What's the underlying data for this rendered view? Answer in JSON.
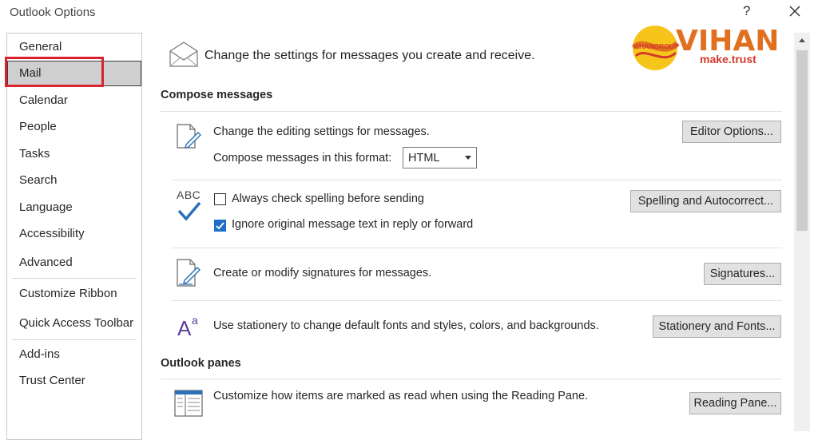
{
  "window": {
    "title": "Outlook Options",
    "help_label": "?"
  },
  "sidebar": {
    "items": [
      {
        "label": "General"
      },
      {
        "label": "Mail"
      },
      {
        "label": "Calendar"
      },
      {
        "label": "People"
      },
      {
        "label": "Tasks"
      },
      {
        "label": "Search"
      },
      {
        "label": "Language"
      },
      {
        "label": "Accessibility"
      },
      {
        "label": "Advanced"
      },
      {
        "label": "Customize Ribbon"
      },
      {
        "label": "Quick Access Toolbar"
      },
      {
        "label": "Add-ins"
      },
      {
        "label": "Trust Center"
      }
    ],
    "selected": "Mail"
  },
  "header": {
    "text": "Change the settings for messages you create and receive."
  },
  "logo": {
    "brand": "VIHAN",
    "tagline": "make.trust",
    "circle_text": "VIHANGROUP"
  },
  "compose": {
    "title": "Compose messages",
    "editing_text": "Change the editing settings for messages.",
    "editor_button": "Editor Options...",
    "format_label": "Compose messages in this format:",
    "format_value": "HTML",
    "abc_label": "ABC",
    "always_check_label": "Always check spelling before sending",
    "always_check_checked": false,
    "ignore_original_label": "Ignore original message text in reply or forward",
    "ignore_original_checked": true,
    "spelling_button": "Spelling and Autocorrect...",
    "signatures_text": "Create or modify signatures for messages.",
    "signatures_button": "Signatures...",
    "stationery_text": "Use stationery to change default fonts and styles, colors, and backgrounds.",
    "stationery_button": "Stationery and Fonts..."
  },
  "panes": {
    "title": "Outlook panes",
    "reading_text": "Customize how items are marked as read when using the Reading Pane.",
    "reading_button": "Reading Pane..."
  },
  "colors": {
    "accent": "#1f6fc6",
    "highlight": "#d9232d",
    "selected_bg": "#cfcfcf"
  }
}
